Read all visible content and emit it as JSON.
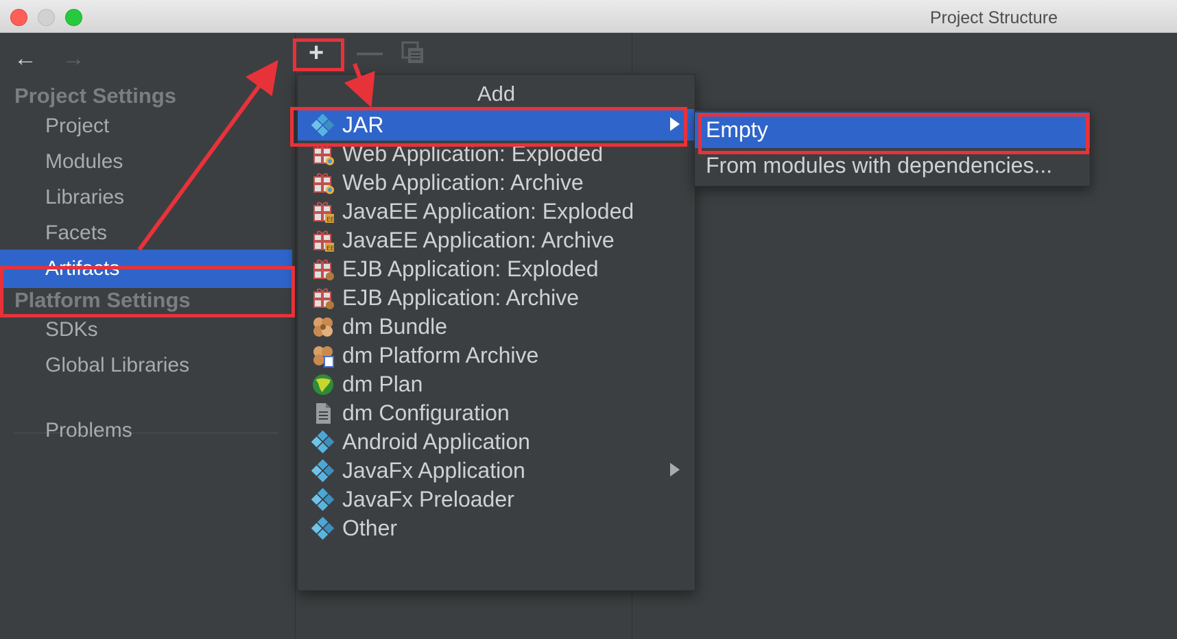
{
  "window": {
    "title": "Project Structure"
  },
  "sidebar": {
    "section_project": "Project Settings",
    "section_platform": "Platform Settings",
    "items": {
      "project": "Project",
      "modules": "Modules",
      "libraries": "Libraries",
      "facets": "Facets",
      "artifacts": "Artifacts",
      "sdks": "SDKs",
      "global_libraries": "Global Libraries",
      "problems": "Problems"
    },
    "selected": "Artifacts"
  },
  "toolbar": {
    "add_icon": "plus-icon",
    "remove_icon": "minus-icon",
    "copy_icon": "copy-icon"
  },
  "add_menu": {
    "title": "Add",
    "items": [
      {
        "label": "JAR",
        "icon": "jar-diamond-icon",
        "has_submenu": true,
        "selected": true
      },
      {
        "label": "Web Application: Exploded",
        "icon": "web-app-icon"
      },
      {
        "label": "Web Application: Archive",
        "icon": "web-app-icon"
      },
      {
        "label": "JavaEE Application: Exploded",
        "icon": "javaee-icon"
      },
      {
        "label": "JavaEE Application: Archive",
        "icon": "javaee-icon"
      },
      {
        "label": "EJB Application: Exploded",
        "icon": "ejb-icon"
      },
      {
        "label": "EJB Application: Archive",
        "icon": "ejb-icon"
      },
      {
        "label": "dm Bundle",
        "icon": "dm-bundle-icon"
      },
      {
        "label": "dm Platform Archive",
        "icon": "dm-platform-icon"
      },
      {
        "label": "dm Plan",
        "icon": "globe-icon"
      },
      {
        "label": "dm Configuration",
        "icon": "document-icon"
      },
      {
        "label": "Android Application",
        "icon": "diamond-icon"
      },
      {
        "label": "JavaFx Application",
        "icon": "diamond-icon",
        "has_submenu": true
      },
      {
        "label": "JavaFx Preloader",
        "icon": "diamond-icon"
      },
      {
        "label": "Other",
        "icon": "diamond-icon"
      }
    ]
  },
  "jar_submenu": {
    "items": [
      {
        "label": "Empty",
        "selected": true
      },
      {
        "label": "From modules with dependencies..."
      }
    ]
  },
  "colors": {
    "background": "#3c3f41",
    "selection": "#2f65ca",
    "highlight_red": "#e8323a",
    "text": "#cfd1d3"
  }
}
